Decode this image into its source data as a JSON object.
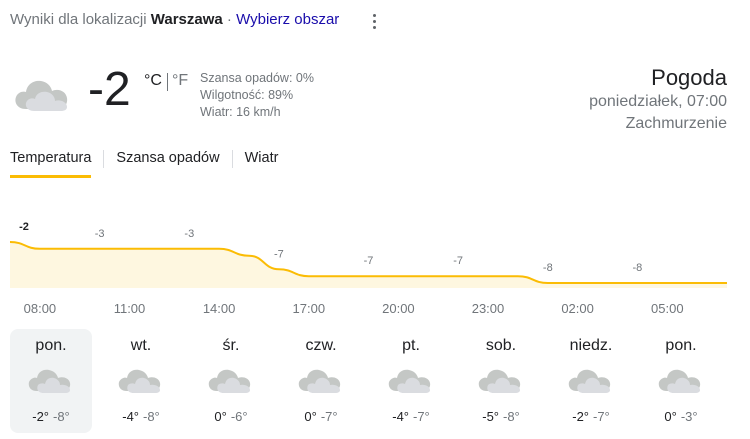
{
  "location": {
    "prefix": "Wyniki dla lokalizacji",
    "city": "Warszawa",
    "separator": "·",
    "change_link": "Wybierz obszar"
  },
  "current": {
    "icon": "cloud-icon",
    "temperature": "-2",
    "unit_c": "°C",
    "unit_f": "°F",
    "active_unit": "C",
    "precip": "Szansa opadów: 0%",
    "humidity": "Wilgotność: 89%",
    "wind": "Wiatr: 16 km/h"
  },
  "summary": {
    "title": "Pogoda",
    "datetime": "poniedziałek, 07:00",
    "condition": "Zachmurzenie"
  },
  "tabs": [
    {
      "label": "Temperatura",
      "active": true
    },
    {
      "label": "Szansa opadów",
      "active": false
    },
    {
      "label": "Wiatr",
      "active": false
    }
  ],
  "colors": {
    "accent": "#fbbc04",
    "chart_fill": "#fef7e0",
    "link": "#1a0dab",
    "selected_bg": "#f1f3f4"
  },
  "chart_data": {
    "type": "area",
    "unit": "°C",
    "times": [
      "07:00",
      "08:00",
      "09:00",
      "10:00",
      "11:00",
      "12:00",
      "13:00",
      "14:00",
      "15:00",
      "16:00",
      "17:00",
      "18:00",
      "19:00",
      "20:00",
      "21:00",
      "22:00",
      "23:00",
      "00:00",
      "01:00",
      "02:00",
      "03:00",
      "04:00",
      "05:00",
      "06:00",
      "07:00"
    ],
    "values": [
      -2,
      -3,
      -3,
      -3,
      -3,
      -3,
      -3,
      -3,
      -4,
      -6,
      -7,
      -7,
      -7,
      -7,
      -7,
      -7,
      -7,
      -7,
      -8,
      -8,
      -8,
      -8,
      -8,
      -8,
      -8
    ],
    "labels": [
      {
        "index": 0,
        "text": "-2"
      },
      {
        "index": 3,
        "text": "-3"
      },
      {
        "index": 6,
        "text": "-3"
      },
      {
        "index": 9,
        "text": "-7"
      },
      {
        "index": 12,
        "text": "-7"
      },
      {
        "index": 15,
        "text": "-7"
      },
      {
        "index": 18,
        "text": "-8"
      },
      {
        "index": 21,
        "text": "-8"
      }
    ],
    "x_ticks": [
      "08:00",
      "11:00",
      "14:00",
      "17:00",
      "20:00",
      "23:00",
      "02:00",
      "05:00"
    ]
  },
  "days": [
    {
      "name": "pon.",
      "high": "-2°",
      "low": "-8°",
      "icon": "cloud-icon",
      "selected": true
    },
    {
      "name": "wt.",
      "high": "-4°",
      "low": "-8°",
      "icon": "cloud-icon",
      "selected": false
    },
    {
      "name": "śr.",
      "high": "0°",
      "low": "-6°",
      "icon": "cloud-icon",
      "selected": false
    },
    {
      "name": "czw.",
      "high": "0°",
      "low": "-7°",
      "icon": "cloud-icon",
      "selected": false
    },
    {
      "name": "pt.",
      "high": "-4°",
      "low": "-7°",
      "icon": "cloud-icon",
      "selected": false
    },
    {
      "name": "sob.",
      "high": "-5°",
      "low": "-8°",
      "icon": "cloud-icon",
      "selected": false
    },
    {
      "name": "niedz.",
      "high": "-2°",
      "low": "-7°",
      "icon": "cloud-icon",
      "selected": false
    },
    {
      "name": "pon.",
      "high": "0°",
      "low": "-3°",
      "icon": "cloud-icon",
      "selected": false
    }
  ]
}
